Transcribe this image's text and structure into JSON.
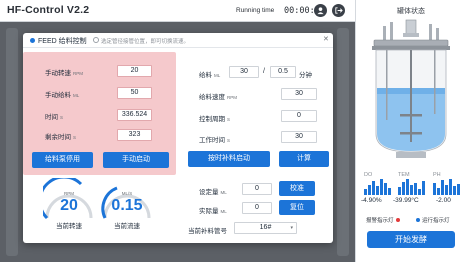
{
  "header": {
    "title": "HF-Control V2.2",
    "running_time_label": "Running time",
    "running_time_value": "00:00:00"
  },
  "right_panel": {
    "title": "罐体状态",
    "stats": [
      {
        "label": "DO",
        "value": "-4.90%"
      },
      {
        "label": "TEM",
        "value": "-39.99°C"
      },
      {
        "label": "PH",
        "value": "-2.00"
      }
    ],
    "legend_alarm": "报警指示灯",
    "legend_run": "运行指示灯",
    "start_button": "开始发酵",
    "colors": {
      "alarm": "#e23b3b",
      "run": "#1c74d8"
    }
  },
  "modal": {
    "title": "FEED 给料控制",
    "hint": "选定管径接管位置，即可切换流速。",
    "left": {
      "manual_speed_label": "手动转速",
      "manual_speed_unit": "RPM",
      "manual_speed_value": "20",
      "manual_feed_label": "手动给料",
      "manual_feed_unit": "ML",
      "manual_feed_value": "50",
      "time_label": "时间",
      "time_unit": "S",
      "time_value": "336.524",
      "remaining_label": "剩余时间",
      "remaining_unit": "S",
      "remaining_value": "323",
      "stop_button": "给料泵停用",
      "start_button": "手动启动"
    },
    "right": {
      "feed_label": "给料",
      "feed_unit": "ML",
      "feed_value": "30",
      "feed_sep": "/",
      "feed_minutes_value": "0.5",
      "feed_minutes_unit": "分钟",
      "speed_label": "给料速度",
      "speed_unit": "RPM",
      "speed_value": "30",
      "period_label": "控制周期",
      "period_unit": "S",
      "period_value": "0",
      "work_label": "工作时间",
      "work_unit": "S",
      "work_value": "30",
      "timed_start_button": "按时补料启动",
      "calc_button": "计算",
      "setpoint_label": "设定量",
      "setpoint_unit": "ML",
      "setpoint_value": "0",
      "calibrate_button": "校准",
      "actual_label": "实际量",
      "actual_unit": "ML",
      "actual_value": "0",
      "reset_button": "复位",
      "pipe_label": "当前补料管号",
      "pipe_value": "16#"
    },
    "gauges": [
      {
        "value": "20",
        "unit": "RPM",
        "caption": "当前转速"
      },
      {
        "value": "0.15",
        "unit": "ML/S",
        "caption": "当前流速"
      }
    ]
  }
}
